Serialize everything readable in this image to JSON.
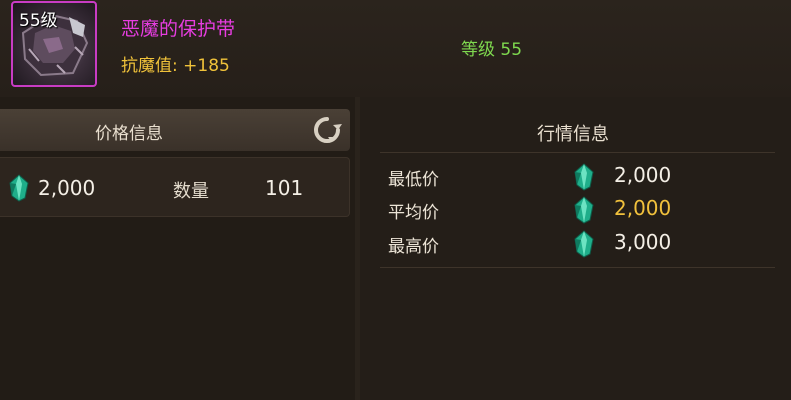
{
  "item": {
    "level_badge": "55级",
    "name": "恶魔的保护带",
    "stat": "抗魔值: +185",
    "level_text": "等级 55",
    "icon": "armor-belt-icon",
    "rarity_color": "#c83cc4"
  },
  "price_panel": {
    "title": "价格信息",
    "refresh_icon": "refresh-icon",
    "price": "2,000",
    "quantity_label": "数量",
    "quantity": "101"
  },
  "market_panel": {
    "title": "行情信息",
    "rows": [
      {
        "label": "最低价",
        "value": "2,000"
      },
      {
        "label": "平均价",
        "value": "2,000"
      },
      {
        "label": "最高价",
        "value": "3,000"
      }
    ]
  },
  "colors": {
    "name": "#e63de0",
    "stat": "#f0c23a",
    "level": "#7fd94f",
    "average_price": "#f1c13c"
  }
}
